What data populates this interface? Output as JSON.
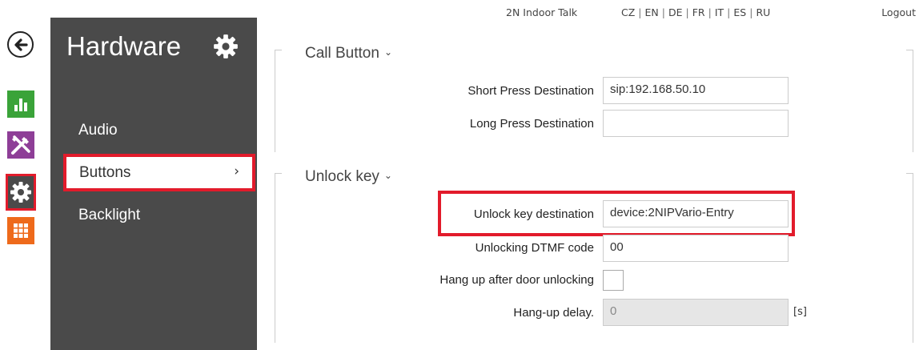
{
  "topbar": {
    "product": "2N Indoor Talk",
    "languages": [
      "CZ",
      "EN",
      "DE",
      "FR",
      "IT",
      "ES",
      "RU"
    ],
    "logout": "Logout"
  },
  "rail": {
    "back": "back-arrow-icon",
    "items": [
      {
        "name": "status",
        "icon": "bar-chart-icon",
        "color": "#3aa339"
      },
      {
        "name": "services",
        "icon": "tools-icon",
        "color": "#8e3e97"
      },
      {
        "name": "hardware",
        "icon": "gear-icon",
        "color": "#4a4a4a",
        "selected": true
      },
      {
        "name": "system",
        "icon": "grid-icon",
        "color": "#ee6a1b"
      }
    ]
  },
  "sidebar": {
    "title": "Hardware",
    "items": [
      {
        "label": "Audio"
      },
      {
        "label": "Buttons",
        "chevron": "›",
        "selected": true
      },
      {
        "label": "Backlight"
      }
    ]
  },
  "call_button": {
    "title": "Call Button",
    "caret": "⌄",
    "fields": [
      {
        "label": "Short Press Destination",
        "value": "sip:192.168.50.10"
      },
      {
        "label": "Long Press Destination",
        "value": ""
      }
    ]
  },
  "unlock_key": {
    "title": "Unlock key",
    "caret": "⌄",
    "fields": [
      {
        "label": "Unlock key destination",
        "value": "device:2NIPVario-Entry"
      },
      {
        "label": "Unlocking DTMF code",
        "value": "00"
      },
      {
        "label": "Hang up after door unlocking",
        "checked": false
      },
      {
        "label": "Hang-up delay.",
        "value": "0",
        "unit": "[s]",
        "disabled": true
      }
    ]
  },
  "colors": {
    "accent_red": "#e21b2b",
    "sidebar_bg": "#4a4a4a"
  }
}
